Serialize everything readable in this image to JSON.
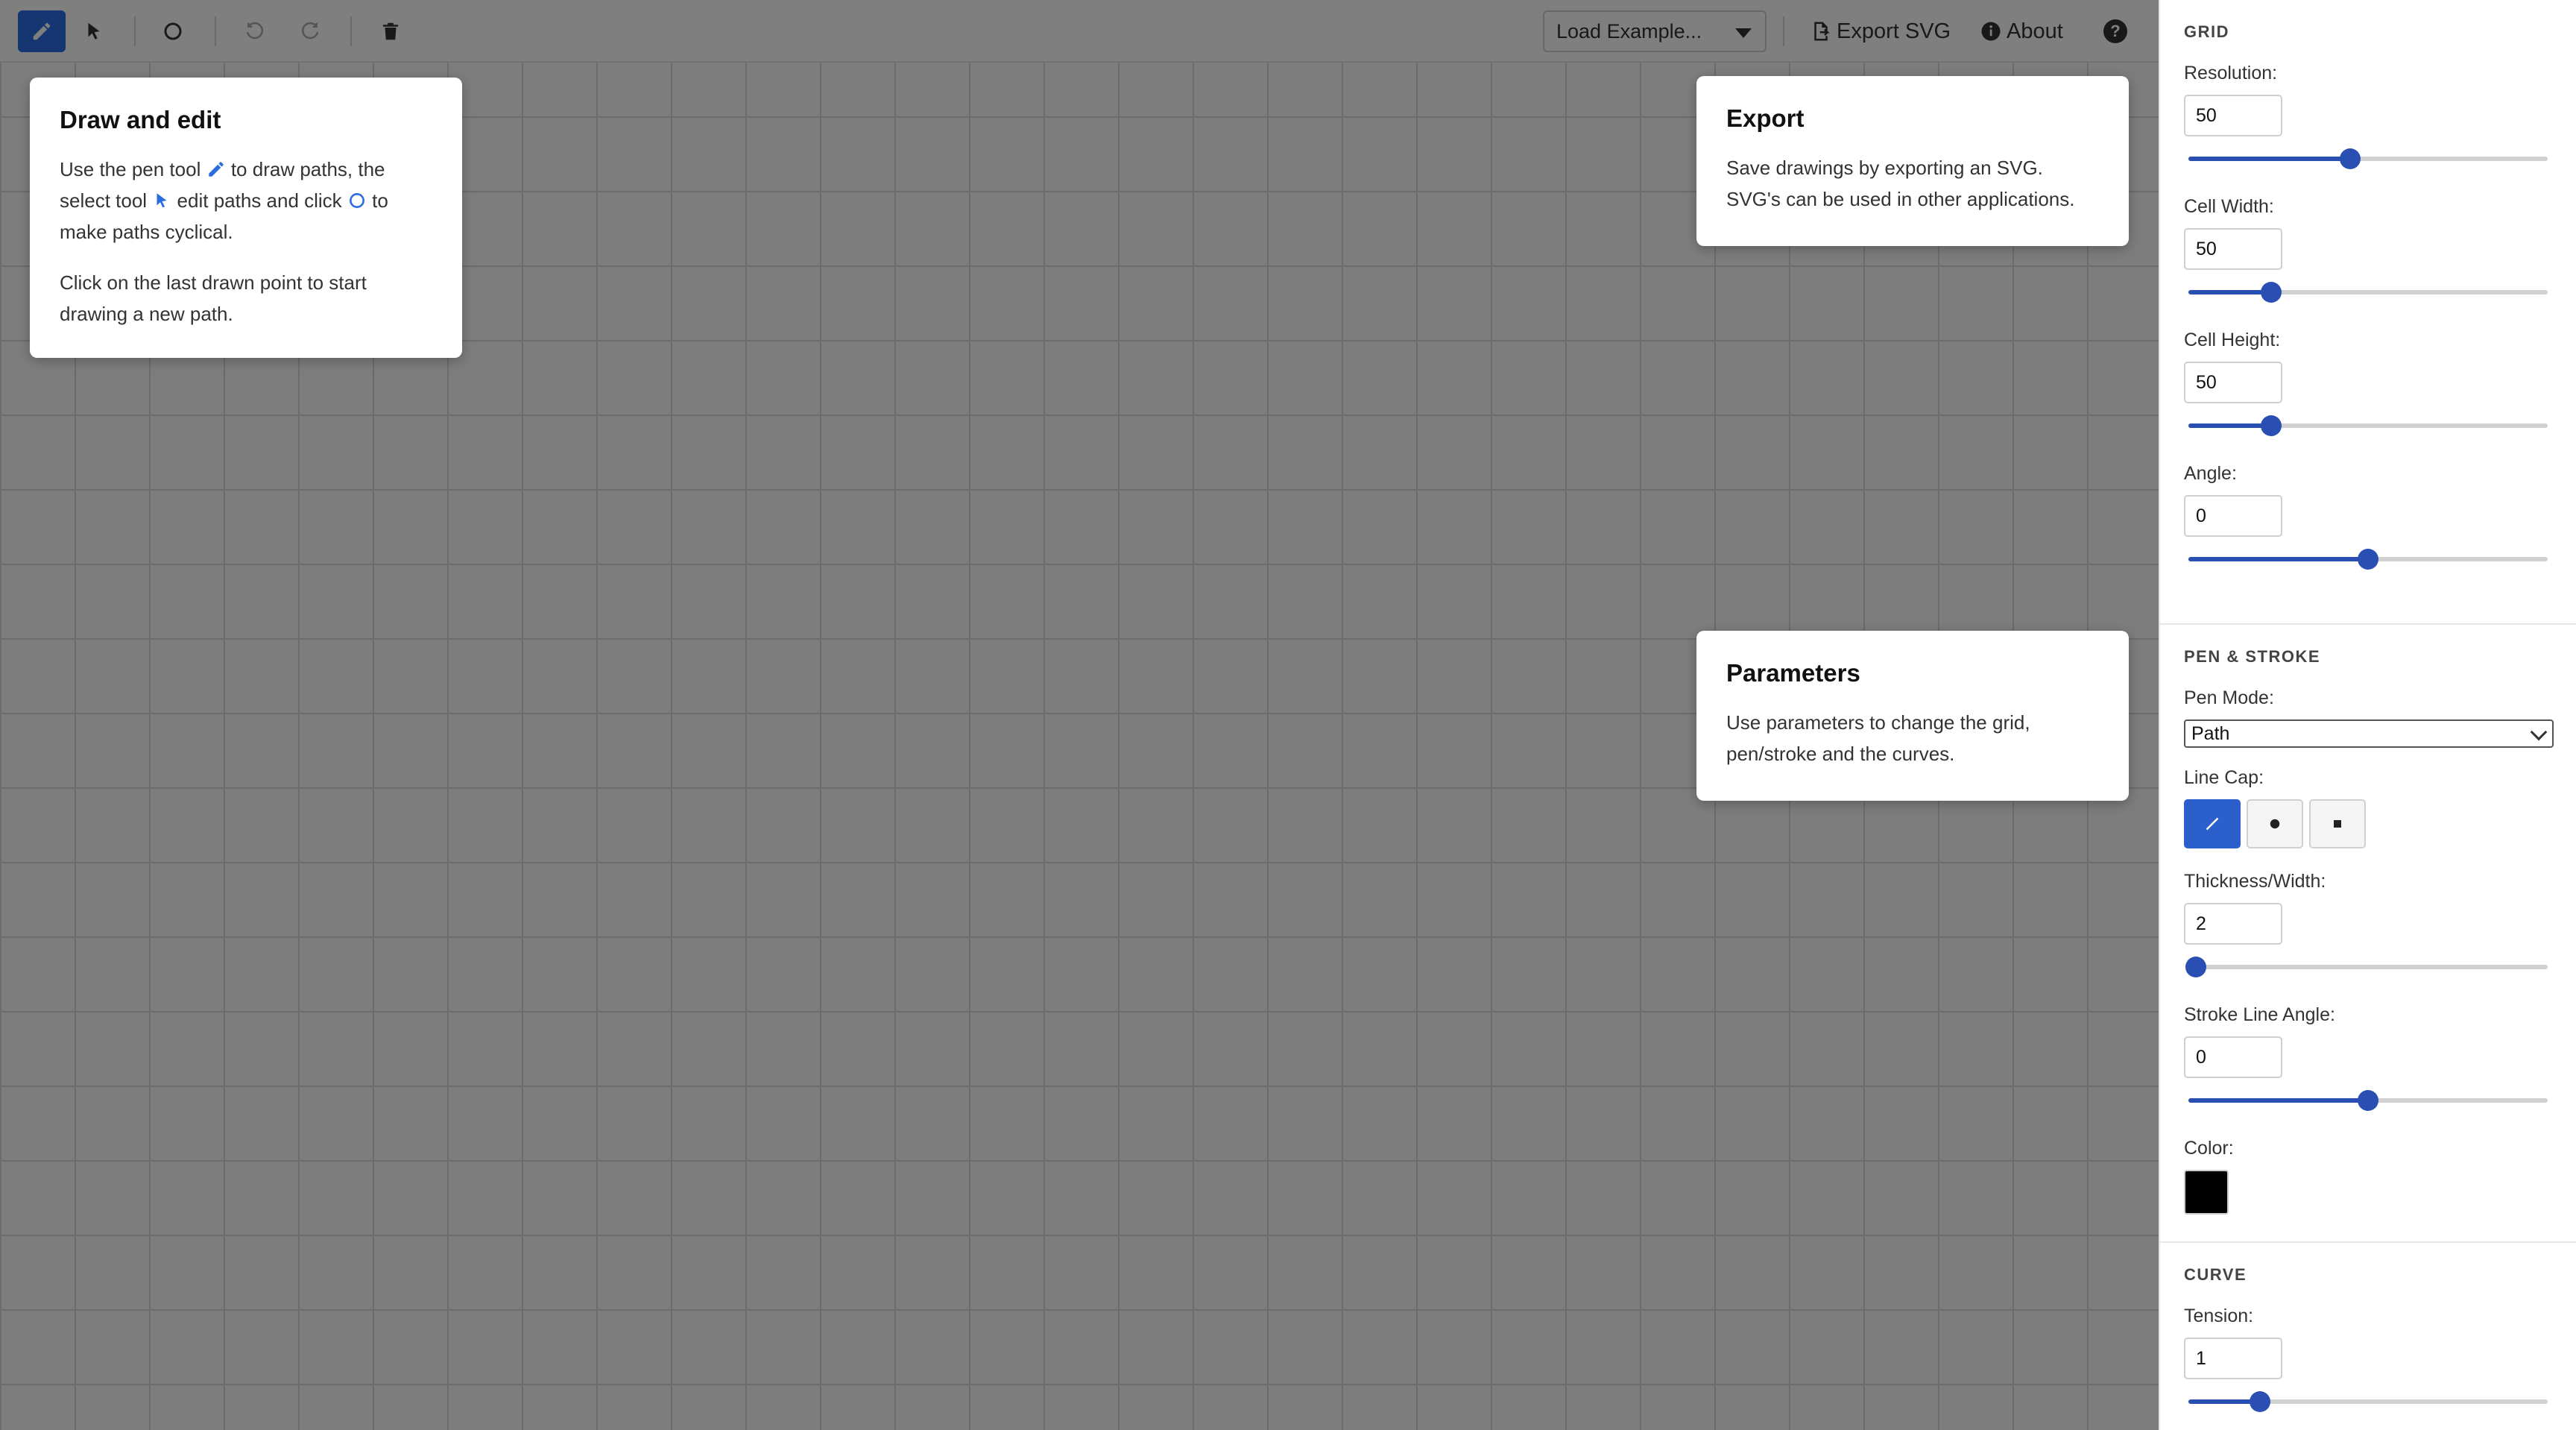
{
  "toolbar": {
    "tools": [
      {
        "name": "pen-tool",
        "icon": "pencil-icon",
        "active": true
      },
      {
        "name": "select-tool",
        "icon": "cursor-icon",
        "active": false
      },
      {
        "name": "cyclic-tool",
        "icon": "circle-icon",
        "active": false
      },
      {
        "name": "undo",
        "icon": "undo-icon",
        "active": false
      },
      {
        "name": "redo",
        "icon": "redo-icon",
        "active": false
      },
      {
        "name": "delete",
        "icon": "trash-icon",
        "active": false
      }
    ],
    "load_example_label": "Load Example...",
    "export_label": "Export SVG",
    "about_label": "About",
    "help_label": "?"
  },
  "tour": {
    "draw_edit": {
      "title": "Draw and edit",
      "p1_a": "Use the pen tool",
      "p1_b": "to draw paths, the select tool",
      "p1_c": "edit paths and click",
      "p1_d": "to make paths cyclical.",
      "p2": "Click on the last drawn point to start drawing a new path."
    },
    "export": {
      "title": "Export",
      "body": "Save drawings by exporting an SVG. SVG's can be used in other applications."
    },
    "parameters": {
      "title": "Parameters",
      "body": "Use parameters to change the grid, pen/stroke and the curves."
    }
  },
  "panel": {
    "grid": {
      "title": "GRID",
      "resolution": {
        "label": "Resolution:",
        "value": "50",
        "slider": 0.45
      },
      "cell_width": {
        "label": "Cell Width:",
        "value": "50",
        "slider": 0.23
      },
      "cell_height": {
        "label": "Cell Height:",
        "value": "50",
        "slider": 0.23
      },
      "angle": {
        "label": "Angle:",
        "value": "0",
        "slider": 0.5
      }
    },
    "pen": {
      "title": "PEN & STROKE",
      "mode": {
        "label": "Pen Mode:",
        "value": "Path"
      },
      "line_cap": {
        "label": "Line Cap:",
        "options": [
          "butt",
          "round",
          "square"
        ],
        "selected": "butt"
      },
      "thickness": {
        "label": "Thickness/Width:",
        "value": "2",
        "slider": 0.02
      },
      "stroke_angle": {
        "label": "Stroke Line Angle:",
        "value": "0",
        "slider": 0.5
      },
      "color": {
        "label": "Color:",
        "value": "#000000"
      }
    },
    "curve": {
      "title": "CURVE",
      "tension": {
        "label": "Tension:",
        "value": "1",
        "slider": 0.2
      }
    }
  },
  "colors": {
    "accent": "#2a6de0",
    "slider": "#2a4fb3"
  }
}
